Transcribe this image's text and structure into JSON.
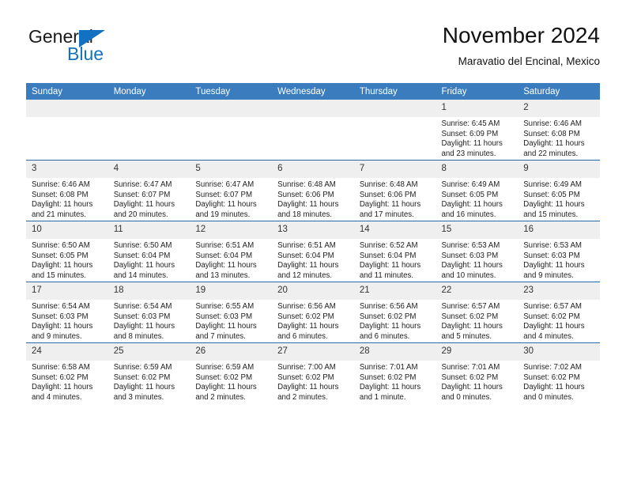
{
  "logo": {
    "word_one": "General",
    "word_two": "Blue",
    "triangle_icon": "blue-triangle-icon",
    "accent_color": "#1271c0"
  },
  "header": {
    "title": "November 2024",
    "subtitle": "Maravatio del Encinal, Mexico"
  },
  "calendar": {
    "header_bg": "#3a7cbe",
    "row_divider_color": "#2b6ca8",
    "daynum_bg": "#efefef",
    "weekday_headers": [
      "Sunday",
      "Monday",
      "Tuesday",
      "Wednesday",
      "Thursday",
      "Friday",
      "Saturday"
    ],
    "weeks": [
      [
        {
          "day": "",
          "lines": []
        },
        {
          "day": "",
          "lines": []
        },
        {
          "day": "",
          "lines": []
        },
        {
          "day": "",
          "lines": []
        },
        {
          "day": "",
          "lines": []
        },
        {
          "day": "1",
          "lines": [
            "Sunrise: 6:45 AM",
            "Sunset: 6:09 PM",
            "Daylight: 11 hours",
            "and 23 minutes."
          ]
        },
        {
          "day": "2",
          "lines": [
            "Sunrise: 6:46 AM",
            "Sunset: 6:08 PM",
            "Daylight: 11 hours",
            "and 22 minutes."
          ]
        }
      ],
      [
        {
          "day": "3",
          "lines": [
            "Sunrise: 6:46 AM",
            "Sunset: 6:08 PM",
            "Daylight: 11 hours",
            "and 21 minutes."
          ]
        },
        {
          "day": "4",
          "lines": [
            "Sunrise: 6:47 AM",
            "Sunset: 6:07 PM",
            "Daylight: 11 hours",
            "and 20 minutes."
          ]
        },
        {
          "day": "5",
          "lines": [
            "Sunrise: 6:47 AM",
            "Sunset: 6:07 PM",
            "Daylight: 11 hours",
            "and 19 minutes."
          ]
        },
        {
          "day": "6",
          "lines": [
            "Sunrise: 6:48 AM",
            "Sunset: 6:06 PM",
            "Daylight: 11 hours",
            "and 18 minutes."
          ]
        },
        {
          "day": "7",
          "lines": [
            "Sunrise: 6:48 AM",
            "Sunset: 6:06 PM",
            "Daylight: 11 hours",
            "and 17 minutes."
          ]
        },
        {
          "day": "8",
          "lines": [
            "Sunrise: 6:49 AM",
            "Sunset: 6:05 PM",
            "Daylight: 11 hours",
            "and 16 minutes."
          ]
        },
        {
          "day": "9",
          "lines": [
            "Sunrise: 6:49 AM",
            "Sunset: 6:05 PM",
            "Daylight: 11 hours",
            "and 15 minutes."
          ]
        }
      ],
      [
        {
          "day": "10",
          "lines": [
            "Sunrise: 6:50 AM",
            "Sunset: 6:05 PM",
            "Daylight: 11 hours",
            "and 15 minutes."
          ]
        },
        {
          "day": "11",
          "lines": [
            "Sunrise: 6:50 AM",
            "Sunset: 6:04 PM",
            "Daylight: 11 hours",
            "and 14 minutes."
          ]
        },
        {
          "day": "12",
          "lines": [
            "Sunrise: 6:51 AM",
            "Sunset: 6:04 PM",
            "Daylight: 11 hours",
            "and 13 minutes."
          ]
        },
        {
          "day": "13",
          "lines": [
            "Sunrise: 6:51 AM",
            "Sunset: 6:04 PM",
            "Daylight: 11 hours",
            "and 12 minutes."
          ]
        },
        {
          "day": "14",
          "lines": [
            "Sunrise: 6:52 AM",
            "Sunset: 6:04 PM",
            "Daylight: 11 hours",
            "and 11 minutes."
          ]
        },
        {
          "day": "15",
          "lines": [
            "Sunrise: 6:53 AM",
            "Sunset: 6:03 PM",
            "Daylight: 11 hours",
            "and 10 minutes."
          ]
        },
        {
          "day": "16",
          "lines": [
            "Sunrise: 6:53 AM",
            "Sunset: 6:03 PM",
            "Daylight: 11 hours",
            "and 9 minutes."
          ]
        }
      ],
      [
        {
          "day": "17",
          "lines": [
            "Sunrise: 6:54 AM",
            "Sunset: 6:03 PM",
            "Daylight: 11 hours",
            "and 9 minutes."
          ]
        },
        {
          "day": "18",
          "lines": [
            "Sunrise: 6:54 AM",
            "Sunset: 6:03 PM",
            "Daylight: 11 hours",
            "and 8 minutes."
          ]
        },
        {
          "day": "19",
          "lines": [
            "Sunrise: 6:55 AM",
            "Sunset: 6:03 PM",
            "Daylight: 11 hours",
            "and 7 minutes."
          ]
        },
        {
          "day": "20",
          "lines": [
            "Sunrise: 6:56 AM",
            "Sunset: 6:02 PM",
            "Daylight: 11 hours",
            "and 6 minutes."
          ]
        },
        {
          "day": "21",
          "lines": [
            "Sunrise: 6:56 AM",
            "Sunset: 6:02 PM",
            "Daylight: 11 hours",
            "and 6 minutes."
          ]
        },
        {
          "day": "22",
          "lines": [
            "Sunrise: 6:57 AM",
            "Sunset: 6:02 PM",
            "Daylight: 11 hours",
            "and 5 minutes."
          ]
        },
        {
          "day": "23",
          "lines": [
            "Sunrise: 6:57 AM",
            "Sunset: 6:02 PM",
            "Daylight: 11 hours",
            "and 4 minutes."
          ]
        }
      ],
      [
        {
          "day": "24",
          "lines": [
            "Sunrise: 6:58 AM",
            "Sunset: 6:02 PM",
            "Daylight: 11 hours",
            "and 4 minutes."
          ]
        },
        {
          "day": "25",
          "lines": [
            "Sunrise: 6:59 AM",
            "Sunset: 6:02 PM",
            "Daylight: 11 hours",
            "and 3 minutes."
          ]
        },
        {
          "day": "26",
          "lines": [
            "Sunrise: 6:59 AM",
            "Sunset: 6:02 PM",
            "Daylight: 11 hours",
            "and 2 minutes."
          ]
        },
        {
          "day": "27",
          "lines": [
            "Sunrise: 7:00 AM",
            "Sunset: 6:02 PM",
            "Daylight: 11 hours",
            "and 2 minutes."
          ]
        },
        {
          "day": "28",
          "lines": [
            "Sunrise: 7:01 AM",
            "Sunset: 6:02 PM",
            "Daylight: 11 hours",
            "and 1 minute."
          ]
        },
        {
          "day": "29",
          "lines": [
            "Sunrise: 7:01 AM",
            "Sunset: 6:02 PM",
            "Daylight: 11 hours",
            "and 0 minutes."
          ]
        },
        {
          "day": "30",
          "lines": [
            "Sunrise: 7:02 AM",
            "Sunset: 6:02 PM",
            "Daylight: 11 hours",
            "and 0 minutes."
          ]
        }
      ]
    ]
  }
}
